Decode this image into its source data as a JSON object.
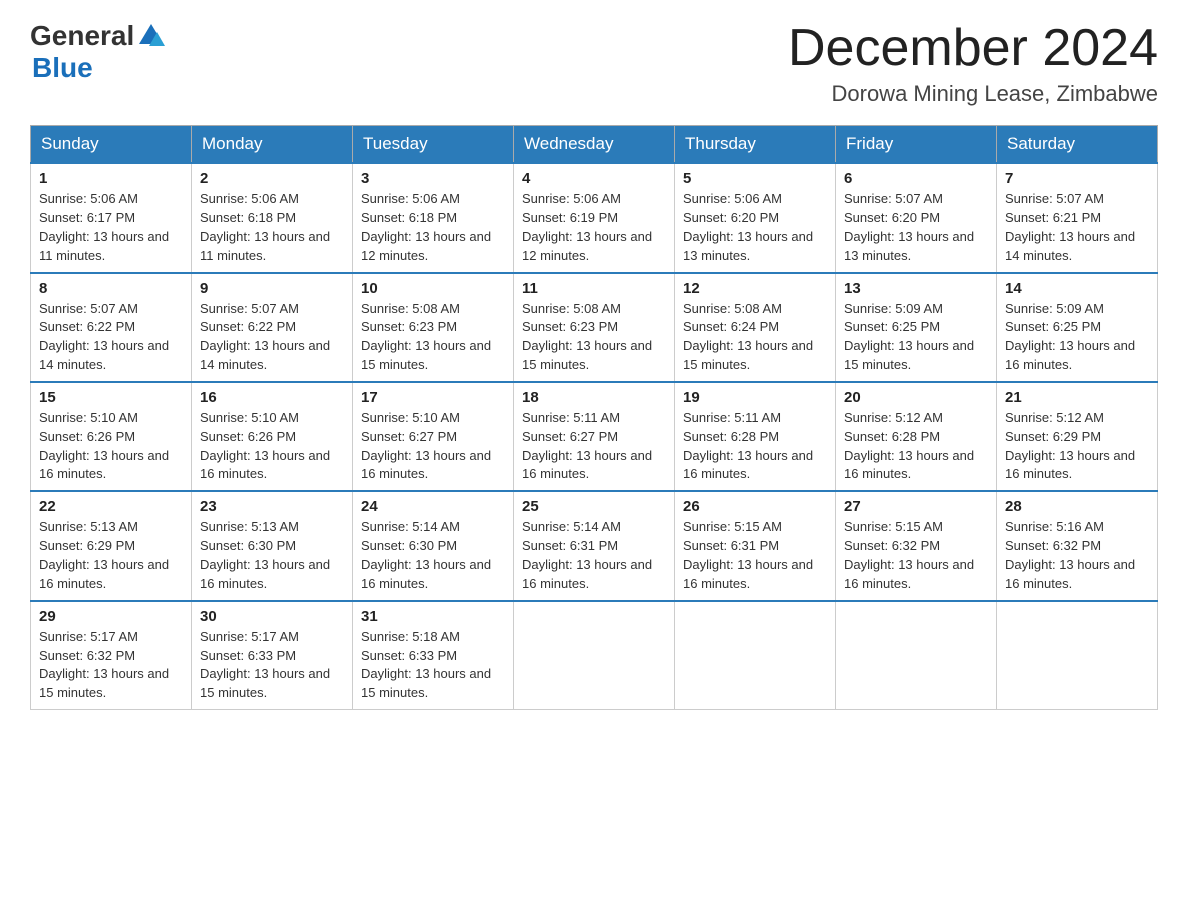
{
  "header": {
    "logo_general": "General",
    "logo_blue": "Blue",
    "month_title": "December 2024",
    "location": "Dorowa Mining Lease, Zimbabwe"
  },
  "days_of_week": [
    "Sunday",
    "Monday",
    "Tuesday",
    "Wednesday",
    "Thursday",
    "Friday",
    "Saturday"
  ],
  "weeks": [
    [
      {
        "day": "1",
        "sunrise": "5:06 AM",
        "sunset": "6:17 PM",
        "daylight": "13 hours and 11 minutes."
      },
      {
        "day": "2",
        "sunrise": "5:06 AM",
        "sunset": "6:18 PM",
        "daylight": "13 hours and 11 minutes."
      },
      {
        "day": "3",
        "sunrise": "5:06 AM",
        "sunset": "6:18 PM",
        "daylight": "13 hours and 12 minutes."
      },
      {
        "day": "4",
        "sunrise": "5:06 AM",
        "sunset": "6:19 PM",
        "daylight": "13 hours and 12 minutes."
      },
      {
        "day": "5",
        "sunrise": "5:06 AM",
        "sunset": "6:20 PM",
        "daylight": "13 hours and 13 minutes."
      },
      {
        "day": "6",
        "sunrise": "5:07 AM",
        "sunset": "6:20 PM",
        "daylight": "13 hours and 13 minutes."
      },
      {
        "day": "7",
        "sunrise": "5:07 AM",
        "sunset": "6:21 PM",
        "daylight": "13 hours and 14 minutes."
      }
    ],
    [
      {
        "day": "8",
        "sunrise": "5:07 AM",
        "sunset": "6:22 PM",
        "daylight": "13 hours and 14 minutes."
      },
      {
        "day": "9",
        "sunrise": "5:07 AM",
        "sunset": "6:22 PM",
        "daylight": "13 hours and 14 minutes."
      },
      {
        "day": "10",
        "sunrise": "5:08 AM",
        "sunset": "6:23 PM",
        "daylight": "13 hours and 15 minutes."
      },
      {
        "day": "11",
        "sunrise": "5:08 AM",
        "sunset": "6:23 PM",
        "daylight": "13 hours and 15 minutes."
      },
      {
        "day": "12",
        "sunrise": "5:08 AM",
        "sunset": "6:24 PM",
        "daylight": "13 hours and 15 minutes."
      },
      {
        "day": "13",
        "sunrise": "5:09 AM",
        "sunset": "6:25 PM",
        "daylight": "13 hours and 15 minutes."
      },
      {
        "day": "14",
        "sunrise": "5:09 AM",
        "sunset": "6:25 PM",
        "daylight": "13 hours and 16 minutes."
      }
    ],
    [
      {
        "day": "15",
        "sunrise": "5:10 AM",
        "sunset": "6:26 PM",
        "daylight": "13 hours and 16 minutes."
      },
      {
        "day": "16",
        "sunrise": "5:10 AM",
        "sunset": "6:26 PM",
        "daylight": "13 hours and 16 minutes."
      },
      {
        "day": "17",
        "sunrise": "5:10 AM",
        "sunset": "6:27 PM",
        "daylight": "13 hours and 16 minutes."
      },
      {
        "day": "18",
        "sunrise": "5:11 AM",
        "sunset": "6:27 PM",
        "daylight": "13 hours and 16 minutes."
      },
      {
        "day": "19",
        "sunrise": "5:11 AM",
        "sunset": "6:28 PM",
        "daylight": "13 hours and 16 minutes."
      },
      {
        "day": "20",
        "sunrise": "5:12 AM",
        "sunset": "6:28 PM",
        "daylight": "13 hours and 16 minutes."
      },
      {
        "day": "21",
        "sunrise": "5:12 AM",
        "sunset": "6:29 PM",
        "daylight": "13 hours and 16 minutes."
      }
    ],
    [
      {
        "day": "22",
        "sunrise": "5:13 AM",
        "sunset": "6:29 PM",
        "daylight": "13 hours and 16 minutes."
      },
      {
        "day": "23",
        "sunrise": "5:13 AM",
        "sunset": "6:30 PM",
        "daylight": "13 hours and 16 minutes."
      },
      {
        "day": "24",
        "sunrise": "5:14 AM",
        "sunset": "6:30 PM",
        "daylight": "13 hours and 16 minutes."
      },
      {
        "day": "25",
        "sunrise": "5:14 AM",
        "sunset": "6:31 PM",
        "daylight": "13 hours and 16 minutes."
      },
      {
        "day": "26",
        "sunrise": "5:15 AM",
        "sunset": "6:31 PM",
        "daylight": "13 hours and 16 minutes."
      },
      {
        "day": "27",
        "sunrise": "5:15 AM",
        "sunset": "6:32 PM",
        "daylight": "13 hours and 16 minutes."
      },
      {
        "day": "28",
        "sunrise": "5:16 AM",
        "sunset": "6:32 PM",
        "daylight": "13 hours and 16 minutes."
      }
    ],
    [
      {
        "day": "29",
        "sunrise": "5:17 AM",
        "sunset": "6:32 PM",
        "daylight": "13 hours and 15 minutes."
      },
      {
        "day": "30",
        "sunrise": "5:17 AM",
        "sunset": "6:33 PM",
        "daylight": "13 hours and 15 minutes."
      },
      {
        "day": "31",
        "sunrise": "5:18 AM",
        "sunset": "6:33 PM",
        "daylight": "13 hours and 15 minutes."
      },
      null,
      null,
      null,
      null
    ]
  ]
}
